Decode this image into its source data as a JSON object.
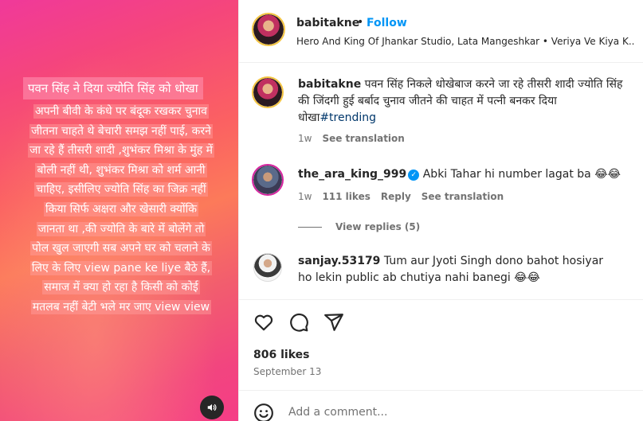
{
  "media": {
    "story_title": "पवन सिंह ने दिया ज्योति सिंह को धोखा",
    "story_lines": [
      "अपनी बीवी के कंधे पर बंदूक रखकर चुनाव",
      "जीतना चाहते थे बेचारी समझ नहीं पाई, करने",
      "जा रहे हैं तीसरी शादी ,शुभंकर मिश्रा के मुंह में",
      "बोली नहीं थी, शुभंकर मिश्रा को शर्म आनी",
      "चाहिए, इसीलिए ज्योति सिंह का जिक्र नहीं",
      "किया सिर्फ अक्षरा और खेसारी क्योंकि",
      "जानता था ,की ज्योति के बारे में बोलेंगे तो",
      "पोल खुल जाएगी सब अपने घर को चलाने के",
      "लिए के लिए view pane ke liye बैठे हैं,",
      "समाज में क्या हो रहा है किसी को कोई",
      "मतलब नहीं बेटी भले मर जाए view view"
    ],
    "sound_icon": "speaker-icon"
  },
  "header": {
    "username": "babitakne",
    "dot": "•",
    "follow_label": "Follow",
    "audio": "Hero And King Of Jhankar Studio, Lata Mangeshkar • Veriya Ve Kiya K..."
  },
  "caption": {
    "username": "babitakne",
    "text": "पवन सिंह निकले धोखेबाज करने जा रहे तीसरी शादी ज्योति सिंह की जिंदगी हुई बर्बाद चुनाव जीतने की चाहत में पत्नी बनकर दिया धोखा",
    "hashtag": "#trending",
    "time": "1w",
    "see_translation": "See translation"
  },
  "comments": [
    {
      "username": "the_ara_king_999",
      "verified": true,
      "text": "Abki Tahar hi number lagat ba 😂😂",
      "time": "1w",
      "likes": "111 likes",
      "reply": "Reply",
      "see_translation": "See translation",
      "view_replies": "View replies (5)"
    },
    {
      "username": "sanjay.53179",
      "text": "Tum aur Jyoti Singh dono bahot hosiyar ho lekin public ab chutiya nahi banegi 😂😂"
    }
  ],
  "actions": {
    "like_icon": "heart-icon",
    "comment_icon": "comment-icon",
    "share_icon": "share-icon",
    "likes": "806 likes",
    "date": "September 13"
  },
  "add_comment": {
    "placeholder": "Add a comment...",
    "emoji_icon": "emoji-icon"
  },
  "colors": {
    "accent": "#0095f6",
    "text": "#262626",
    "muted": "#737373",
    "gradient_pink": "#f0399a",
    "gradient_orange": "#fc7a5a"
  }
}
